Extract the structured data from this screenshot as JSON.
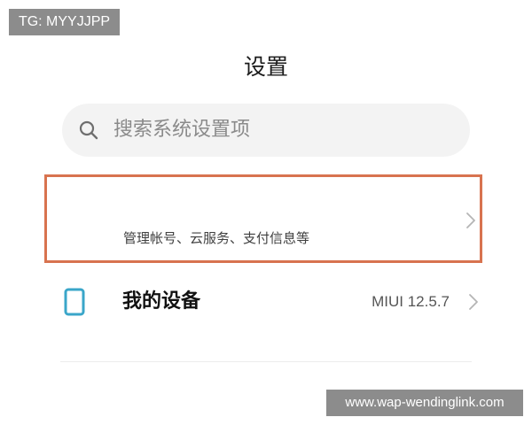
{
  "overlay": {
    "tg_label": "TG: MYYJJPP",
    "site_label": "www.wap-wendinglink.com"
  },
  "header": {
    "title": "设置"
  },
  "search": {
    "placeholder": "搜索系统设置项",
    "icon": "search-icon"
  },
  "account": {
    "subtitle": "管理帐号、云服务、支付信息等",
    "highlight_color": "#d8734f",
    "icon": "chevron-right-icon"
  },
  "device": {
    "title": "我的设备",
    "version": "MIUI 12.5.7",
    "icon": "phone-icon",
    "icon_color": "#3aa6c9"
  }
}
